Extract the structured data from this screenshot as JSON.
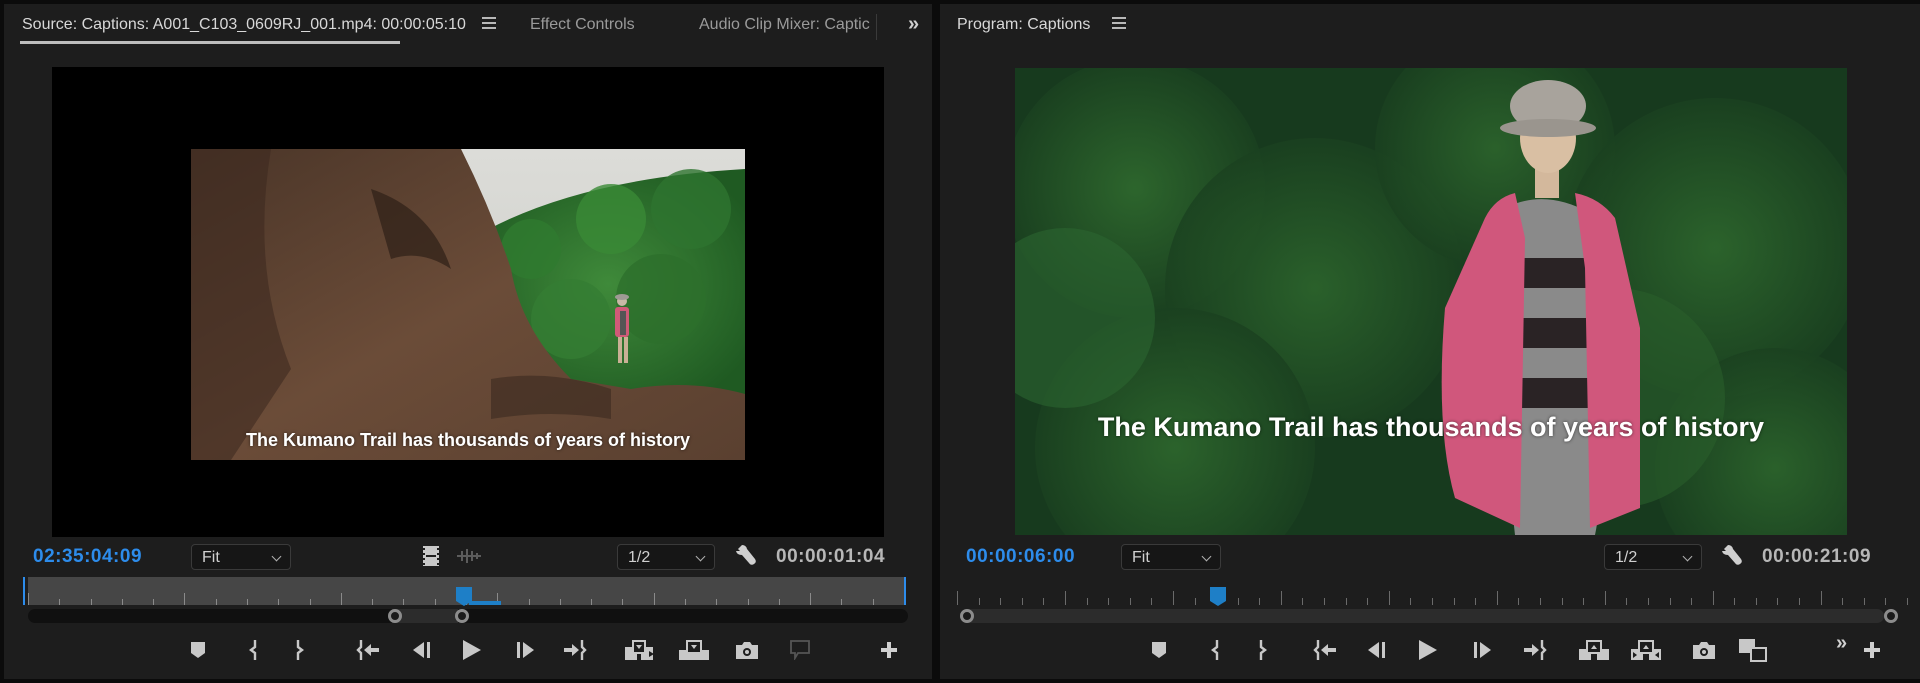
{
  "source": {
    "tabs": [
      {
        "label": "Source: Captions: A001_C103_0609RJ_001.mp4: 00:00:05:10",
        "active": true
      },
      {
        "label": "Effect Controls",
        "active": false
      },
      {
        "label": "Audio Clip Mixer: Captic",
        "active": false
      }
    ],
    "overflow_icon": "»",
    "menu_icon": "hamburger-menu-icon",
    "caption": "The Kumano Trail has thousands of years of history",
    "current_timecode": "02:35:04:09",
    "zoom_select": "Fit",
    "resolution_select": "1/2",
    "duration_timecode": "00:00:01:04",
    "playhead_position": 0.5,
    "controls": [
      "add-marker",
      "mark-in",
      "mark-out",
      "go-to-in",
      "step-back",
      "play",
      "step-forward",
      "go-to-out",
      "insert",
      "overwrite",
      "export-frame",
      "captions-comment",
      "button-editor"
    ]
  },
  "program": {
    "tab": {
      "label": "Program: Captions",
      "active": true
    },
    "menu_icon": "hamburger-menu-icon",
    "caption": "The Kumano Trail has thousands of years of history",
    "current_timecode": "00:00:06:00",
    "zoom_select": "Fit",
    "resolution_select": "1/2",
    "duration_timecode": "00:00:21:09",
    "playhead_position": 0.28,
    "controls": [
      "add-marker",
      "mark-in",
      "mark-out",
      "go-to-in",
      "step-back",
      "play",
      "step-forward",
      "go-to-out",
      "lift",
      "extract",
      "export-frame",
      "comparison-view",
      "overflow",
      "button-editor"
    ]
  },
  "colors": {
    "accent_blue": "#2d8ceb",
    "panel_bg": "#1d1d1d",
    "video_bg": "#000000"
  }
}
